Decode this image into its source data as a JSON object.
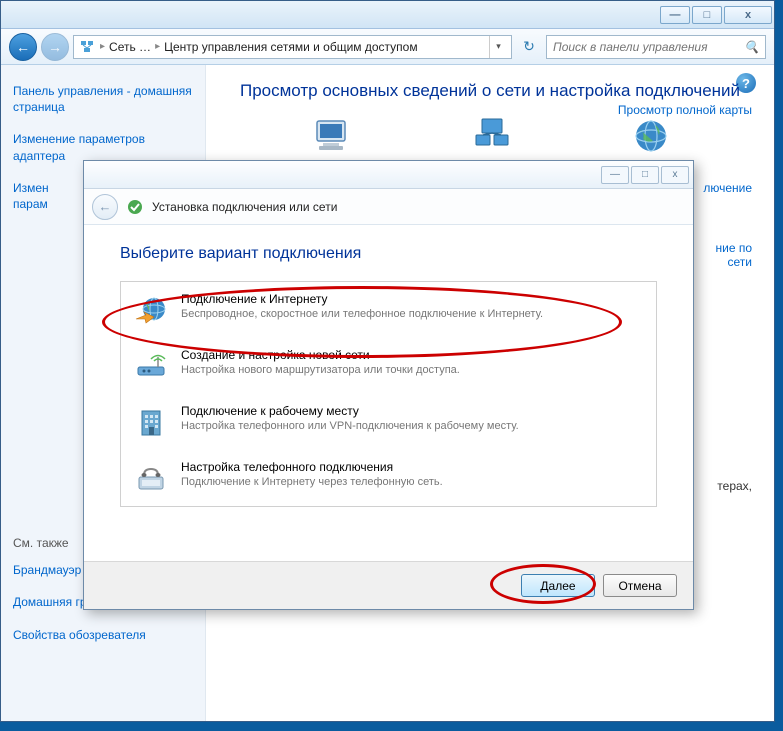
{
  "titlebar": {
    "minimize": "—",
    "maximize": "□",
    "close": "x"
  },
  "nav": {
    "back": "←",
    "forward": "→",
    "refresh": "↻"
  },
  "breadcrumb": {
    "item1": "Сеть …",
    "item2": "Центр управления сетями и общим доступом",
    "sep": "▸"
  },
  "search": {
    "placeholder": "Поиск в панели управления",
    "icon": "🔍"
  },
  "help": {
    "icon": "?"
  },
  "sidebar": {
    "link1": "Панель управления - домашняя страница",
    "link2": "Изменение параметров адаптера",
    "link3_line1": "Измен",
    "link3_line2": "парам",
    "see_also": "См. также",
    "link4": "Брандмауэр Windows",
    "link5": "Домашняя группа",
    "link6": "Свойства обозревателя"
  },
  "main": {
    "title": "Просмотр основных сведений о сети и настройка подключений",
    "map_link": "Просмотр полной карты",
    "node1": "DESKTOP",
    "node2": "Сеть",
    "node3": "Интернет",
    "partial1": "лючение",
    "partial2": "ние по",
    "partial3": "сети",
    "partial4": "терах,"
  },
  "dialog": {
    "titlebar": {
      "minimize": "—",
      "maximize": "□",
      "close": "x"
    },
    "back": "←",
    "header": "Установка подключения или сети",
    "heading": "Выберите вариант подключения",
    "options": [
      {
        "title": "Подключение к Интернету",
        "desc": "Беспроводное, скоростное или телефонное подключение к Интернету."
      },
      {
        "title": "Создание и настройка новой сети",
        "desc": "Настройка нового маршрутизатора или точки доступа."
      },
      {
        "title": "Подключение к рабочему месту",
        "desc": "Настройка телефонного или VPN-подключения к рабочему месту."
      },
      {
        "title": "Настройка телефонного подключения",
        "desc": "Подключение к Интернету через телефонную сеть."
      }
    ],
    "next": "Далее",
    "cancel": "Отмена"
  }
}
